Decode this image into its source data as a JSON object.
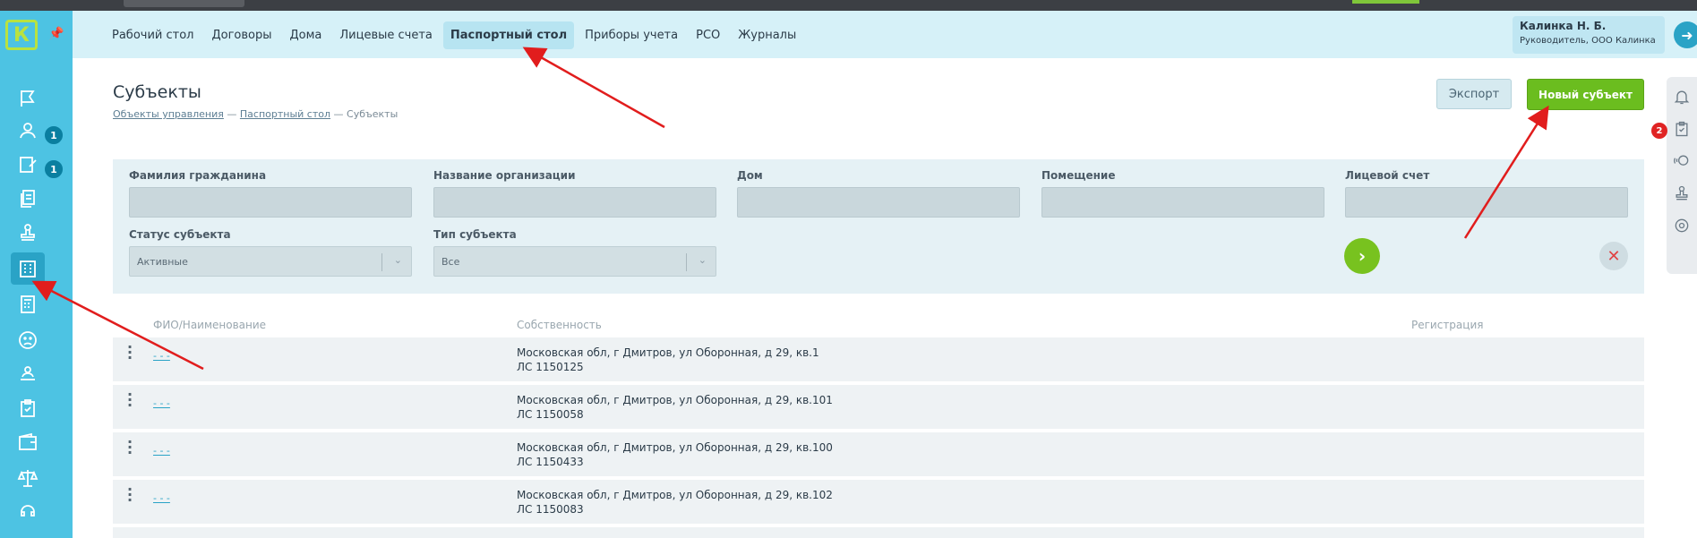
{
  "app": {
    "logo_letter": "К"
  },
  "topnav": {
    "items": [
      {
        "label": "Рабочий стол",
        "active": false
      },
      {
        "label": "Договоры",
        "active": false
      },
      {
        "label": "Дома",
        "active": false
      },
      {
        "label": "Лицевые счета",
        "active": false
      },
      {
        "label": "Паспортный стол",
        "active": true
      },
      {
        "label": "Приборы учета",
        "active": false
      },
      {
        "label": "РСО",
        "active": false
      },
      {
        "label": "Журналы",
        "active": false
      }
    ]
  },
  "user": {
    "name": "Калинка Н. Б.",
    "role": "Руководитель, ООО Калинка"
  },
  "sidebar": {
    "badges": [
      "1",
      "1"
    ],
    "icons": [
      "flag-icon",
      "users-icon",
      "edit-document-icon",
      "documents-icon",
      "stamp-icon",
      "building-icon",
      "calculator-icon",
      "sad-face-icon",
      "people-board-icon",
      "clipboard-check-icon",
      "wallet-icon",
      "scales-icon",
      "phone-icon"
    ]
  },
  "rightrail": {
    "badge": "2",
    "icons": [
      "bell-icon",
      "clipboard-icon",
      "support-icon",
      "stamp-icon",
      "gear-icon"
    ]
  },
  "page": {
    "title": "Субъекты",
    "breadcrumb": [
      "Объекты управления",
      "Паспортный стол",
      "Субъекты"
    ],
    "breadcrumb_sep": "—",
    "export_label": "Экспорт",
    "new_label": "Новый субъект"
  },
  "filters": {
    "surname_label": "Фамилия гражданина",
    "org_label": "Название организации",
    "house_label": "Дом",
    "room_label": "Помещение",
    "account_label": "Лицевой счет",
    "status_label": "Статус субъекта",
    "status_value": "Активные",
    "type_label": "Тип субъекта",
    "type_value": "Все"
  },
  "table": {
    "headers": [
      "ФИО/Наименование",
      "Собственность",
      "Регистрация"
    ],
    "rows": [
      {
        "name": "- - -",
        "address": "Московская обл, г Дмитров, ул Оборонная, д 29, кв.1",
        "account": "ЛС 1150125"
      },
      {
        "name": "- - -",
        "address": "Московская обл, г Дмитров, ул Оборонная, д 29, кв.101",
        "account": "ЛС 1150058"
      },
      {
        "name": "- - -",
        "address": "Московская обл, г Дмитров, ул Оборонная, д 29, кв.100",
        "account": "ЛС 1150433"
      },
      {
        "name": "- - -",
        "address": "Московская обл, г Дмитров, ул Оборонная, д 29, кв.102",
        "account": "ЛС 1150083"
      }
    ]
  },
  "colors": {
    "sidebar": "#4dc3e3",
    "topnav": "#d6f1f8",
    "accent_green": "#6bbd1f",
    "annotation": "#e11d1d"
  }
}
